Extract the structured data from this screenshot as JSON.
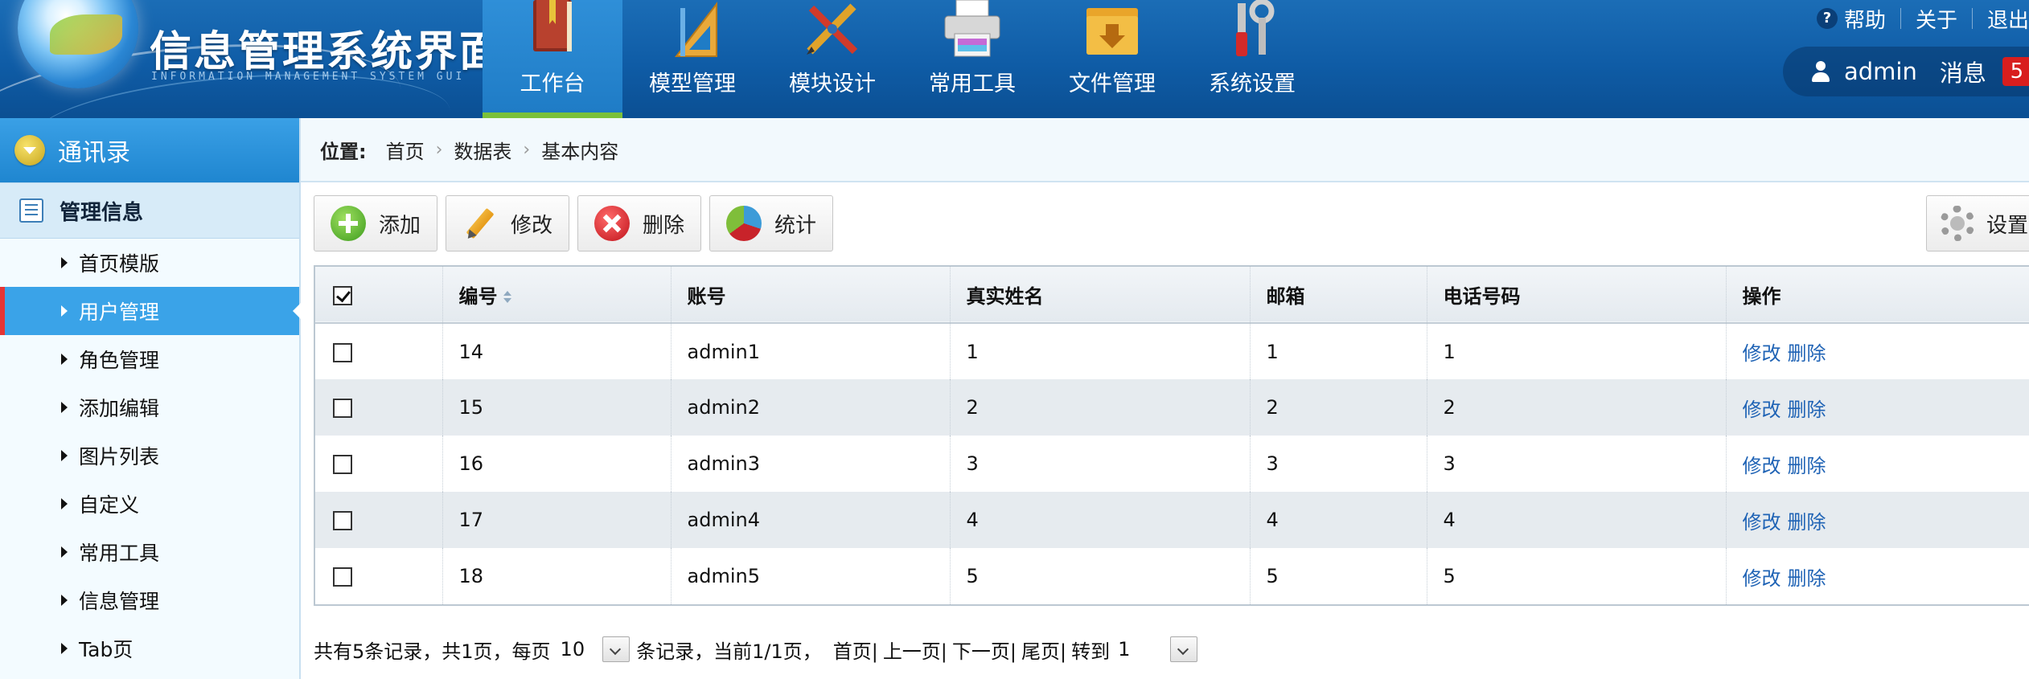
{
  "app": {
    "title": "信息管理系统界面",
    "subtitle": "INFORMATION MANAGEMENT SYSTEM GUI"
  },
  "nav": [
    {
      "label": "工作台",
      "icon": "book-icon",
      "active": true
    },
    {
      "label": "模型管理",
      "icon": "ruler-icon",
      "active": false
    },
    {
      "label": "模块设计",
      "icon": "pencil-ruler-icon",
      "active": false
    },
    {
      "label": "常用工具",
      "icon": "printer-icon",
      "active": false
    },
    {
      "label": "文件管理",
      "icon": "folder-icon",
      "active": false
    },
    {
      "label": "系统设置",
      "icon": "tools-icon",
      "active": false
    }
  ],
  "top_links": {
    "help": "帮助",
    "about": "关于",
    "logout": "退出"
  },
  "user": {
    "name": "admin",
    "messages_label": "消息",
    "message_count": "5"
  },
  "sidebar": {
    "header": "通讯录",
    "group": "管理信息",
    "items": [
      {
        "label": "首页模版",
        "active": false
      },
      {
        "label": "用户管理",
        "active": true
      },
      {
        "label": "角色管理",
        "active": false
      },
      {
        "label": "添加编辑",
        "active": false
      },
      {
        "label": "图片列表",
        "active": false
      },
      {
        "label": "自定义",
        "active": false
      },
      {
        "label": "常用工具",
        "active": false
      },
      {
        "label": "信息管理",
        "active": false
      },
      {
        "label": "Tab页",
        "active": false
      }
    ]
  },
  "breadcrumb": {
    "label": "位置:",
    "items": [
      "首页",
      "数据表",
      "基本内容"
    ]
  },
  "toolbar": {
    "add": "添加",
    "edit": "修改",
    "delete": "删除",
    "stats": "统计",
    "settings": "设置"
  },
  "table": {
    "columns": [
      "编号",
      "账号",
      "真实姓名",
      "邮箱",
      "电话号码",
      "操作"
    ],
    "rows": [
      {
        "id": "14",
        "account": "admin1",
        "name": "1",
        "email": "1",
        "phone": "1"
      },
      {
        "id": "15",
        "account": "admin2",
        "name": "2",
        "email": "2",
        "phone": "2"
      },
      {
        "id": "16",
        "account": "admin3",
        "name": "3",
        "email": "3",
        "phone": "3"
      },
      {
        "id": "17",
        "account": "admin4",
        "name": "4",
        "email": "4",
        "phone": "4"
      },
      {
        "id": "18",
        "account": "admin5",
        "name": "5",
        "email": "5",
        "phone": "5"
      }
    ],
    "edit_link": "修改",
    "delete_link": "删除"
  },
  "pager": {
    "summary": "共有5条记录，共1页，每页",
    "page_size": "10",
    "after_select": "条记录，当前1/1页，",
    "first": "首页|",
    "prev": "上一页|",
    "next": "下一页|",
    "last": "尾页|",
    "goto": "转到",
    "goto_value": "1"
  },
  "colors": {
    "header_blue": "#0f5ca6",
    "nav_active": "#1f7cc6",
    "nav_active_underline": "#7bc13a",
    "sidebar_active": "#3aa3e8",
    "sidebar_active_marker": "#e53535",
    "badge_red": "#d81e1e",
    "link_blue": "#1f63b5"
  }
}
